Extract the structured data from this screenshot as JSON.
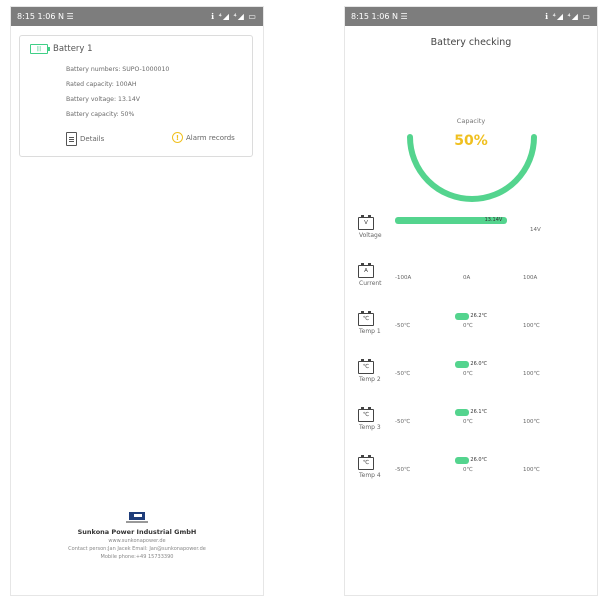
{
  "left": {
    "status": {
      "time": "8:15 1:06 N ☰",
      "icons": "ℹ ⁴◢ ⁴◢ ▭"
    },
    "card": {
      "title": "Battery 1",
      "battery_icon_text": "|||",
      "lines": [
        "Battery numbers: SUPO-1000010",
        "Rated capacity: 100AH",
        "Battery voltage: 13.14V",
        "Battery capacity: 50%"
      ],
      "details_label": "Details",
      "alarm_label": "Alarm records",
      "alarm_icon_text": "!"
    },
    "footer": {
      "company": "Sunkona Power Industrial GmbH",
      "website": "www.sunkonapower.de",
      "contact": "Contact person:Jan Jacek Email: Jan@sunkonapower.de",
      "phone": "Mobile phone:+49 15733390"
    }
  },
  "right": {
    "status": {
      "time": "8:15 1:06 N ☰",
      "icons": "ℹ ⁴◢ ⁴◢ ▭"
    },
    "title": "Battery checking",
    "capacity": {
      "label": "Capacity",
      "value": "50%",
      "fraction": 0.5,
      "color": "#54d48e",
      "value_color": "#f0c020"
    },
    "rows": [
      {
        "icon": "V",
        "label": "Voltage",
        "ticks": [
          "",
          "",
          "14V"
        ],
        "fill_start": 0.0,
        "fill_end": 0.93,
        "value_text": "13.14V"
      },
      {
        "icon": "A",
        "label": "Current",
        "ticks": [
          "-100A",
          "0A",
          "100A"
        ],
        "fill_start": 0.5,
        "fill_end": 0.5,
        "value_text": ""
      },
      {
        "icon": "℃",
        "label": "Temp 1",
        "ticks": [
          "-50℃",
          "0℃",
          "100℃"
        ],
        "fill_start": 0.5,
        "fill_end": 0.62,
        "value_text": "26.2℃"
      },
      {
        "icon": "℃",
        "label": "Temp 2",
        "ticks": [
          "-50℃",
          "0℃",
          "100℃"
        ],
        "fill_start": 0.5,
        "fill_end": 0.62,
        "value_text": "26.0℃"
      },
      {
        "icon": "℃",
        "label": "Temp 3",
        "ticks": [
          "-50℃",
          "0℃",
          "100℃"
        ],
        "fill_start": 0.5,
        "fill_end": 0.62,
        "value_text": "26.1℃"
      },
      {
        "icon": "℃",
        "label": "Temp 4",
        "ticks": [
          "-50℃",
          "0℃",
          "100℃"
        ],
        "fill_start": 0.5,
        "fill_end": 0.62,
        "value_text": "26.0℃"
      }
    ]
  }
}
